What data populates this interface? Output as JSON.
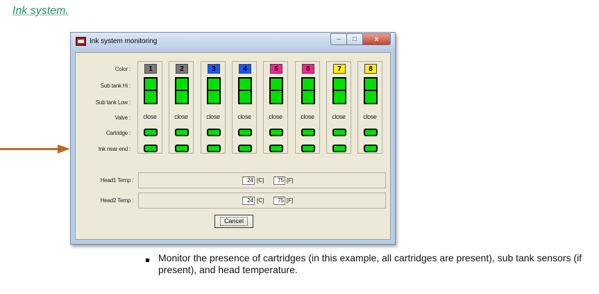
{
  "doc": {
    "heading": "Ink system.",
    "bullet": "Monitor the presence of cartridges (in this example, all cartridges are present), sub tank sensors (if present), and head temperature.",
    "arrow_color": "#b96a28"
  },
  "window": {
    "title": "Ink system monitoring",
    "buttons": {
      "minimize": "–",
      "maximize": "□",
      "close": "x"
    }
  },
  "rows": {
    "color": "Color :",
    "sub_hi": "Sub tank Hi :",
    "sub_low": "Sub tank Low :",
    "valve": "Valve :",
    "cartridge": "Cartridge :",
    "ink_near_end": "Ink near end :"
  },
  "channels": [
    {
      "number": "1",
      "color": "#7a7a7a",
      "valve": "close"
    },
    {
      "number": "2",
      "color": "#7a7a7a",
      "valve": "close"
    },
    {
      "number": "3",
      "color": "#1a55ff",
      "valve": "close"
    },
    {
      "number": "4",
      "color": "#1a55ff",
      "valve": "close"
    },
    {
      "number": "5",
      "color": "#ff1f8c",
      "valve": "close"
    },
    {
      "number": "6",
      "color": "#ff1f8c",
      "valve": "close"
    },
    {
      "number": "7",
      "color": "#ffee22",
      "valve": "close"
    },
    {
      "number": "8",
      "color": "#ffee22",
      "valve": "close"
    }
  ],
  "temps": [
    {
      "label": "Head1 Temp :",
      "c": "24",
      "c_unit": "[C]",
      "f": "75",
      "f_unit": "[F]"
    },
    {
      "label": "Head2 Temp :",
      "c": "24",
      "c_unit": "[C]",
      "f": "75",
      "f_unit": "[F]"
    }
  ],
  "cancel_label": "Cancel",
  "indicator_color": "#00e000"
}
